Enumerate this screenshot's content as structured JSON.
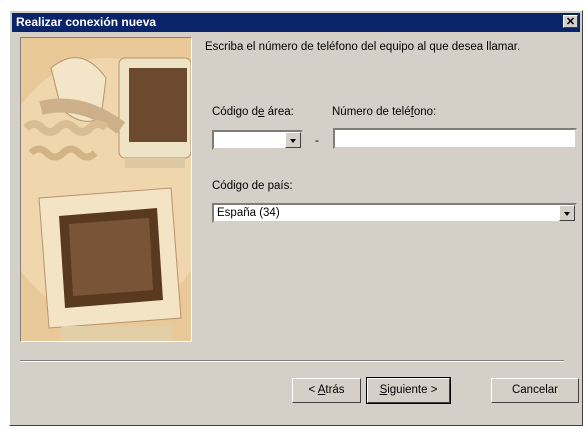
{
  "window": {
    "title": "Realizar conexión nueva",
    "close_glyph": "✕"
  },
  "prompt": "Escriba el número de teléfono del equipo al que desea llamar.",
  "area_code": {
    "label_pre": "Código d",
    "label_key": "e",
    "label_post": " área:",
    "value": ""
  },
  "phone": {
    "label_pre": "Número de telé",
    "label_key": "f",
    "label_post": "ono:",
    "value": ""
  },
  "separator": "-",
  "country": {
    "label_pre": "Códi",
    "label_key": "g",
    "label_post": "o de país:",
    "value": "España (34)"
  },
  "buttons": {
    "back": {
      "pre": "< ",
      "key": "A",
      "post": "trás"
    },
    "next": {
      "pre": "",
      "key": "S",
      "post": "iguiente >"
    },
    "cancel": "Cancelar"
  },
  "icons": {
    "close": "close-icon",
    "dropdown": "chevron-down-icon",
    "illustration": "computer-phone-illustration"
  }
}
